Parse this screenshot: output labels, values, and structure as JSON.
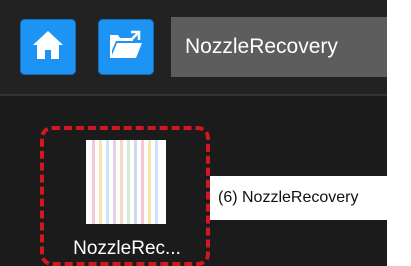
{
  "toolbar": {
    "home_icon": "home-icon",
    "folder_icon": "folder-open-icon",
    "path_value": "NozzleRecovery",
    "accent_color": "#1d93f3"
  },
  "file_tile": {
    "label": "NozzleRec...",
    "thumbnail_icon": "nozzle-pattern-thumbnail"
  },
  "annotation": {
    "callout_text": "(6) NozzleRecovery",
    "highlight_color": "#d0181f"
  }
}
